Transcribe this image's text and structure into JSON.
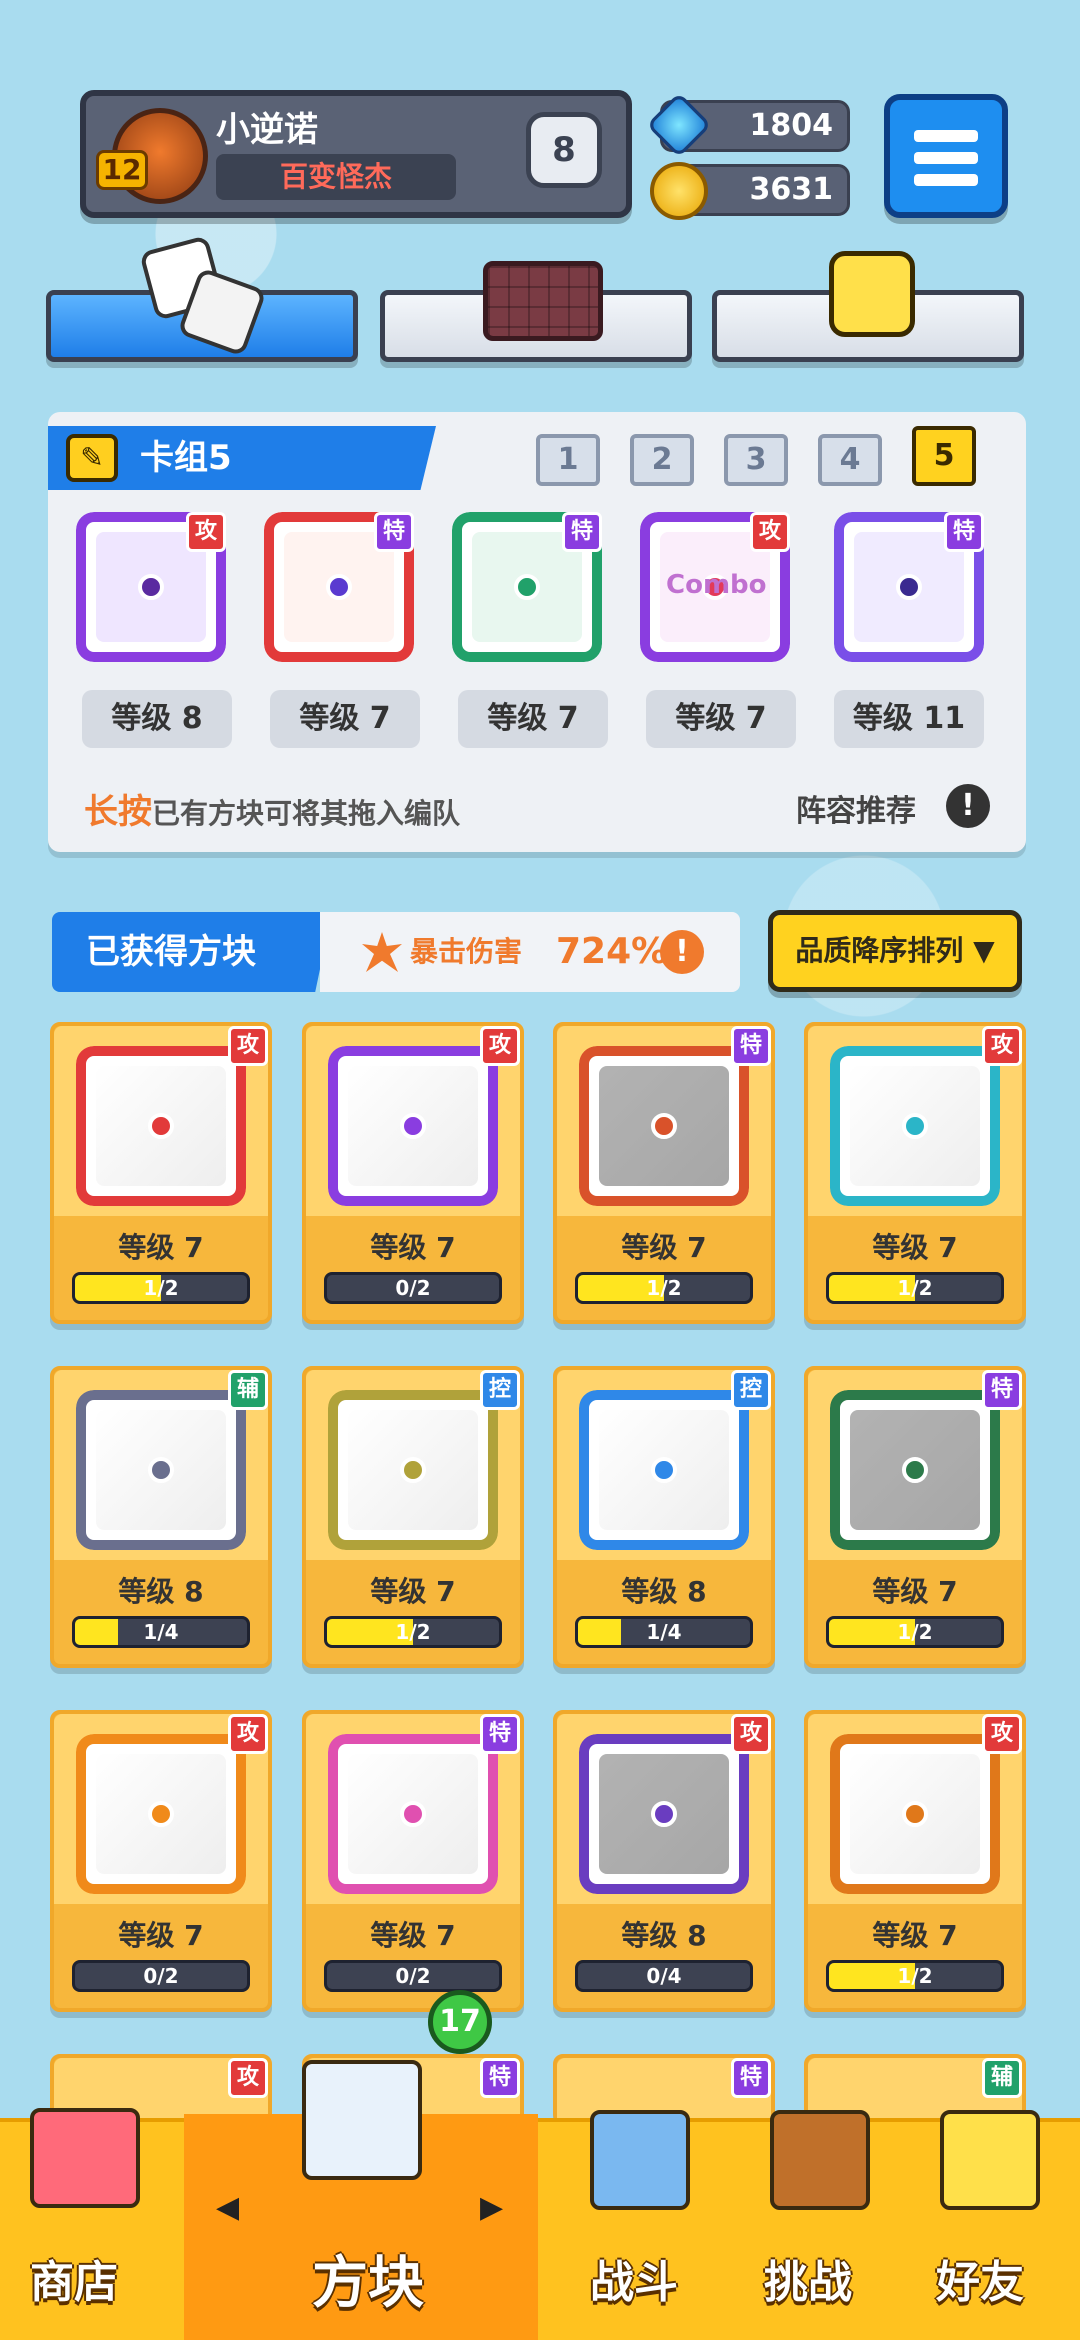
{
  "player": {
    "name": "小逆诺",
    "level": "12",
    "title": "百变怪杰",
    "rank": "8"
  },
  "currency": {
    "gems": "1804",
    "coins": "3631"
  },
  "deck": {
    "title": "卡组5",
    "numbers": [
      "1",
      "2",
      "3",
      "4",
      "5"
    ],
    "active_number": "5",
    "cards": [
      {
        "tag": "攻",
        "level": "等级 8",
        "color": "#8a3de0"
      },
      {
        "tag": "特",
        "level": "等级 7",
        "color": "#e23a3a"
      },
      {
        "tag": "特",
        "level": "等级 7",
        "color": "#21a16a"
      },
      {
        "tag": "攻",
        "level": "等级 7",
        "color": "#8a3de0",
        "text": "Combo"
      },
      {
        "tag": "特",
        "level": "等级 11",
        "color": "#7a4fe8"
      }
    ],
    "hint_emphasis": "长按",
    "hint_text": "已有方块可将其拖入编队",
    "recommend": "阵容推荐",
    "recommend_icon": "!"
  },
  "owned": {
    "title": "已获得方块",
    "crit_label": "暴击伤害",
    "crit_value": "724%",
    "crit_icon": "!",
    "sort_label": "品质降序排列 ▼",
    "cards": [
      {
        "tag": "攻",
        "level": "等级 7",
        "progress": "1/2",
        "fill": 0.5,
        "color": "#e23a3a"
      },
      {
        "tag": "攻",
        "level": "等级 7",
        "progress": "0/2",
        "fill": 0,
        "color": "#8a3de0"
      },
      {
        "tag": "特",
        "level": "等级 7",
        "progress": "1/2",
        "fill": 0.5,
        "color": "#d9522a",
        "checked": true
      },
      {
        "tag": "攻",
        "level": "等级 7",
        "progress": "1/2",
        "fill": 0.5,
        "color": "#2bb5c8"
      },
      {
        "tag": "辅",
        "level": "等级 8",
        "progress": "1/4",
        "fill": 0.25,
        "color": "#6a6f8e"
      },
      {
        "tag": "控",
        "level": "等级 7",
        "progress": "1/2",
        "fill": 0.5,
        "color": "#b0a23a"
      },
      {
        "tag": "控",
        "level": "等级 8",
        "progress": "1/4",
        "fill": 0.25,
        "color": "#2f88e8"
      },
      {
        "tag": "特",
        "level": "等级 7",
        "progress": "1/2",
        "fill": 0.5,
        "color": "#2c7a4a",
        "checked": true
      },
      {
        "tag": "攻",
        "level": "等级 7",
        "progress": "0/2",
        "fill": 0,
        "color": "#f08a1a"
      },
      {
        "tag": "特",
        "level": "等级 7",
        "progress": "0/2",
        "fill": 0,
        "color": "#e050b0"
      },
      {
        "tag": "攻",
        "level": "等级 8",
        "progress": "0/4",
        "fill": 0,
        "color": "#6a3dc0",
        "checked": true
      },
      {
        "tag": "攻",
        "level": "等级 7",
        "progress": "1/2",
        "fill": 0.5,
        "color": "#e0781a"
      }
    ],
    "partial_tags": [
      "攻",
      "特",
      "特",
      "辅"
    ]
  },
  "nav": {
    "shop": "商店",
    "blocks": "方块",
    "battle": "战斗",
    "challenge": "挑战",
    "friends": "好友",
    "blocks_badge": "17",
    "prev": "◀",
    "next": "▶"
  }
}
